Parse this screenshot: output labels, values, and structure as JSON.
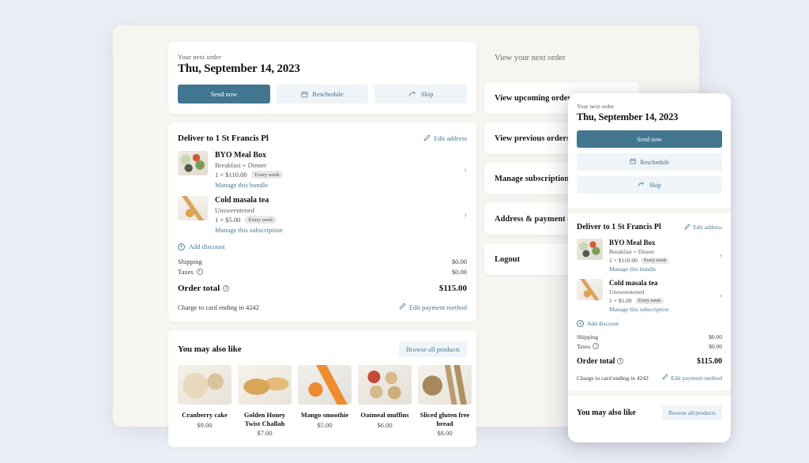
{
  "colors": {
    "page_bg": "#eceef5",
    "backdrop": "#f7f5f0",
    "card": "#ffffff",
    "accent": "#427690",
    "ghost_bg": "#eff4f8",
    "link": "#4a7a95"
  },
  "order": {
    "eyebrow": "Your next order",
    "date": "Thu, September 14, 2023",
    "actions": {
      "send_now": "Send now",
      "reschedule": "Reschedule",
      "skip": "Skip"
    }
  },
  "delivery": {
    "title": "Deliver to 1 St Francis Pl",
    "edit_address": "Edit address",
    "items": [
      {
        "name": "BYO Meal Box",
        "subtitle": "Breakfast + Dinner",
        "price": "1 × $110.00",
        "frequency": "Every week",
        "manage": "Manage this bundle"
      },
      {
        "name": "Cold masala tea",
        "subtitle": "Unsweentened",
        "price": "1 × $5.00",
        "frequency": "Every week",
        "manage": "Manage this subscription"
      }
    ],
    "add_discount": "Add discount",
    "summary": [
      {
        "label": "Shipping",
        "value": "$0.00",
        "info": false
      },
      {
        "label": "Taxes",
        "value": "$0.00",
        "info": true
      }
    ],
    "total": {
      "label": "Order total",
      "value": "$115.00"
    },
    "charge": "Charge to card ending in 4242",
    "edit_payment": "Edit payment method"
  },
  "recommendations": {
    "title": "You may also like",
    "browse": "Browse all products",
    "products": [
      {
        "name": "Cranberry cake",
        "price": "$9.00"
      },
      {
        "name": "Golden Honey Twist Challah",
        "price": "$7.00"
      },
      {
        "name": "Mango smoothie",
        "price": "$5.00"
      },
      {
        "name": "Oatmeal muffins",
        "price": "$6.00"
      },
      {
        "name": "Sliced gluten free bread",
        "price": "$8.00"
      }
    ]
  },
  "menu": {
    "items": [
      {
        "label": "View your next order",
        "active": true,
        "arrow": ""
      },
      {
        "label": "View upcoming orders",
        "active": false,
        "arrow": "›"
      },
      {
        "label": "View previous orders",
        "active": false,
        "arrow": ""
      },
      {
        "label": "Manage subscriptions",
        "active": false,
        "arrow": ""
      },
      {
        "label": "Address & payment details",
        "active": false,
        "arrow": ""
      },
      {
        "label": "Logout",
        "active": false,
        "arrow": ""
      }
    ]
  },
  "icons": {
    "calendar": "calendar-icon",
    "skip_arrow": "skip-arrow-icon",
    "pencil": "pencil-icon",
    "chevron": "›",
    "plus": "+",
    "info": "i"
  }
}
